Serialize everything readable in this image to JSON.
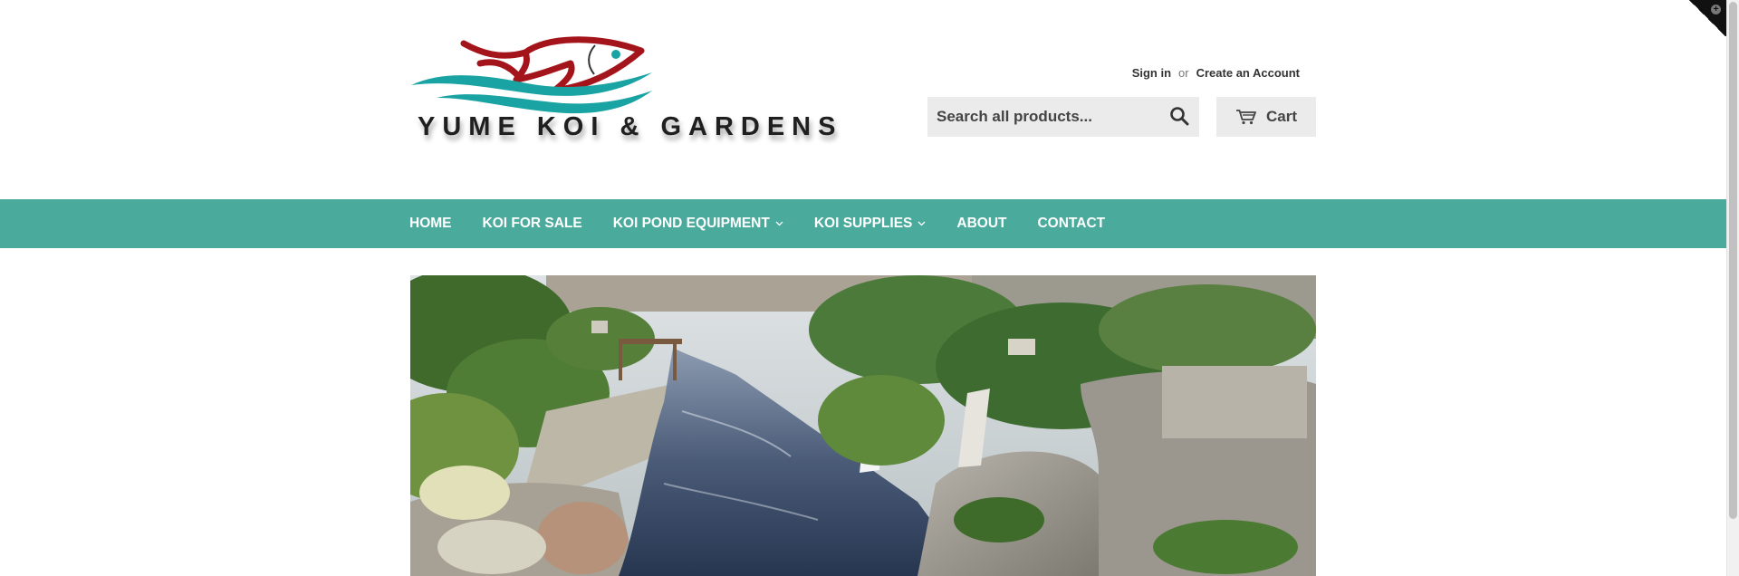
{
  "brand": {
    "name": "YUME KOI & GARDENS",
    "colors": {
      "fish_red": "#a4141b",
      "wave_teal": "#1aa3a3",
      "nav": "#4aaa9c"
    }
  },
  "account": {
    "sign_in": "Sign in",
    "separator": "or",
    "create_account": "Create an Account"
  },
  "search": {
    "placeholder": "Search all products...",
    "icon": "search-icon"
  },
  "cart": {
    "label": "Cart",
    "icon": "cart-icon"
  },
  "nav": {
    "items": [
      {
        "label": "HOME"
      },
      {
        "label": "KOI FOR SALE"
      },
      {
        "label": "KOI POND EQUIPMENT",
        "dropdown": true
      },
      {
        "label": "KOI SUPPLIES",
        "dropdown": true
      },
      {
        "label": "ABOUT"
      },
      {
        "label": "CONTACT"
      }
    ]
  },
  "hero": {
    "image": "koi-pond-garden-photo"
  }
}
